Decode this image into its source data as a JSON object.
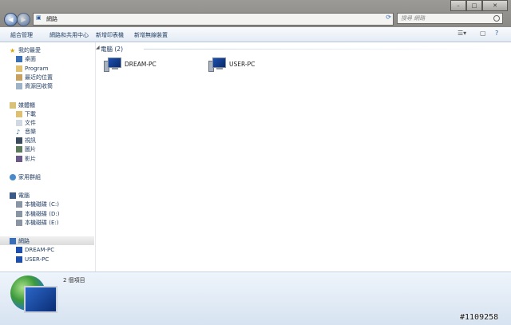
{
  "address": {
    "crumb": "網路"
  },
  "search": {
    "placeholder": "搜尋 網路"
  },
  "toolbar": {
    "items": [
      "組合管理",
      "網路和共用中心",
      "新增印表機",
      "新增無線裝置"
    ],
    "view_icon": "view-options-icon",
    "preview_icon": "preview-pane-icon",
    "help_icon": "help-icon"
  },
  "sidebar": {
    "favorites": {
      "label": "我的最愛",
      "items": [
        "桌面",
        "Program",
        "最近的位置",
        "資源回收筒"
      ]
    },
    "libraries": {
      "label": "媒體櫃",
      "items": [
        "下載",
        "文件",
        "音樂",
        "視訊",
        "圖片",
        "影片"
      ]
    },
    "homegroup": {
      "label": "家用群組"
    },
    "computer": {
      "label": "電腦",
      "items": [
        "本機磁碟 (C:)",
        "本機磁碟 (D:)",
        "本機磁碟 (E:)"
      ]
    },
    "network": {
      "label": "網路",
      "items": [
        "DREAM-PC",
        "USER-PC"
      ]
    }
  },
  "main": {
    "group_label": "電腦 (2)",
    "computers": [
      "DREAM-PC",
      "USER-PC"
    ]
  },
  "details": {
    "count": "2 個項目"
  },
  "watermark": "#1109258",
  "colors": {
    "accent": "#1e3a5f",
    "selection": "#dcdcdc"
  }
}
